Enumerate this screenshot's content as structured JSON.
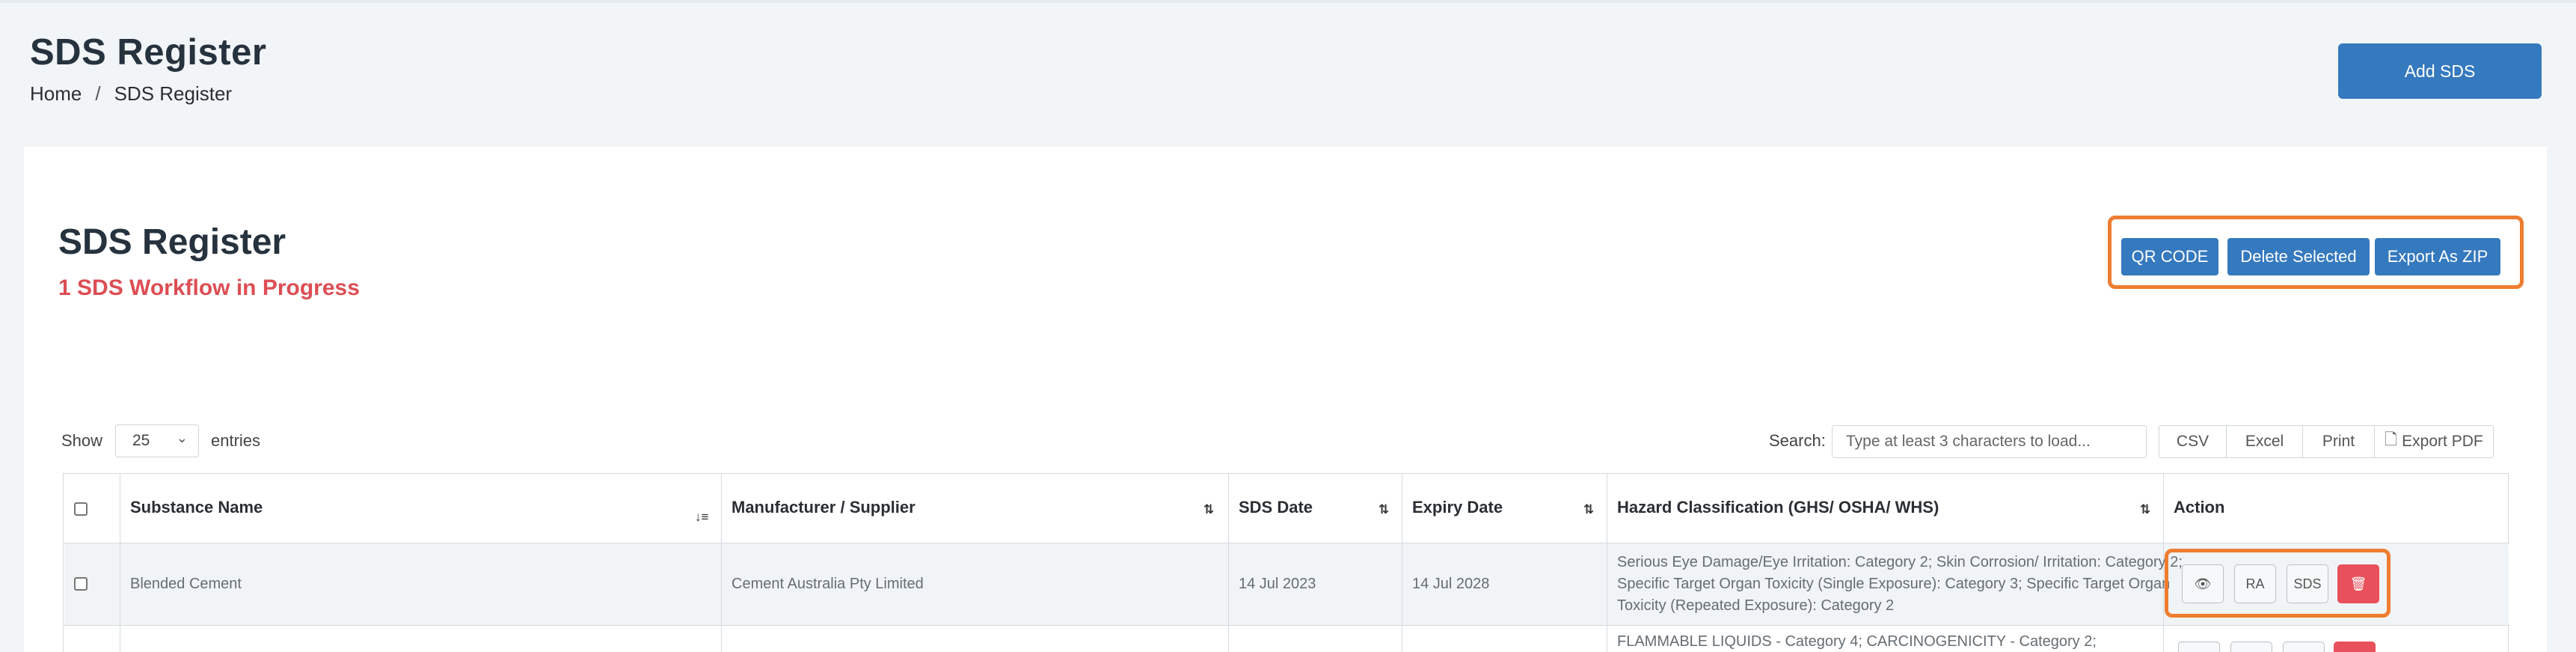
{
  "header": {
    "title": "SDS Register",
    "breadcrumb": {
      "home": "Home",
      "separator": "/",
      "current": "SDS Register"
    },
    "add_button": "Add SDS"
  },
  "card": {
    "title": "SDS Register",
    "workflow_status": "1 SDS Workflow in Progress",
    "buttons": {
      "qr_code": "QR CODE",
      "delete_selected": "Delete Selected",
      "export_zip": "Export As ZIP"
    }
  },
  "controls": {
    "show_label": "Show",
    "entries_value": "25",
    "entries_label": "entries",
    "search_label": "Search:",
    "search_placeholder": "Type at least 3 characters to load...",
    "exports": [
      "CSV",
      "Excel",
      "Print",
      "Export PDF"
    ]
  },
  "table": {
    "headers": {
      "substance": "Substance Name",
      "manufacturer": "Manufacturer / Supplier",
      "sds_date": "SDS Date",
      "expiry_date": "Expiry Date",
      "hazard": "Hazard Classification (GHS/ OSHA/ WHS)",
      "action": "Action"
    },
    "rows": [
      {
        "substance": "Blended Cement",
        "manufacturer": "Cement Australia Pty Limited",
        "sds_date": "14 Jul 2023",
        "expiry_date": "14 Jul 2028",
        "hazard": "Serious Eye Damage/Eye Irritation: Category 2; Skin Corrosion/ Irritation: Category 2; Specific Target Organ Toxicity (Single Exposure): Category 3; Specific Target Organ Toxicity (Repeated Exposure): Category 2",
        "actions": {
          "view": "view-icon",
          "ra": "RA",
          "sds": "SDS",
          "delete": "trash-icon"
        }
      },
      {
        "hazard": "FLAMMABLE LIQUIDS - Category 4; CARCINOGENICITY - Category 2;"
      }
    ]
  },
  "colors": {
    "primary": "#3579be",
    "danger": "#e8505b",
    "highlight": "#ee7d30",
    "workflow": "#dc4e54"
  }
}
